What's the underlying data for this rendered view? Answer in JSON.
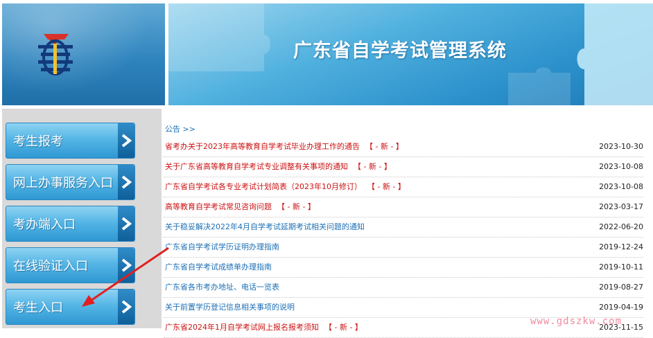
{
  "header": {
    "system_title": "广东省自学考试管理系统",
    "logo_icon": "provincial-emblem-icon",
    "colors": {
      "banner": "#2a8fca",
      "logo_panel": "#2f84be"
    }
  },
  "nav": {
    "items": [
      {
        "label": "考生报考"
      },
      {
        "label": "网上办事服务入口"
      },
      {
        "label": "考办端入口"
      },
      {
        "label": "在线验证入口"
      },
      {
        "label": "考生入口"
      }
    ],
    "arrow_icon": "chevron-right-icon"
  },
  "notices": {
    "header": "公告 >>",
    "new_badge": "【 - 新 - 】",
    "items": [
      {
        "title": "省考办关于2023年高等教育自学考试毕业办理工作的通告",
        "date": "2023-10-30",
        "is_new": true
      },
      {
        "title": "关于广东省高等教育自学考试专业调整有关事项的通知",
        "date": "2023-10-08",
        "is_new": true
      },
      {
        "title": "广东省自学考试各专业考试计划简表（2023年10月修订）",
        "date": "2023-10-08",
        "is_new": true
      },
      {
        "title": "高等教育自学考试常见咨询问题",
        "date": "2023-03-17",
        "is_new": true
      },
      {
        "title": "关于稳妥解决2022年4月自学考试延期考试相关问题的通知",
        "date": "2022-06-20",
        "is_new": false
      },
      {
        "title": "广东省自学考试学历证明办理指南",
        "date": "2019-12-24",
        "is_new": false
      },
      {
        "title": "广东省自学考试成绩单办理指南",
        "date": "2019-10-11",
        "is_new": false
      },
      {
        "title": "广东省各市考办地址、电话一览表",
        "date": "2019-08-27",
        "is_new": false
      },
      {
        "title": "关于前置学历登记信息相关事项的说明",
        "date": "2019-04-19",
        "is_new": false
      },
      {
        "title": "广东省2024年1月自学考试网上报名报考须知",
        "date": "2023-11-15",
        "is_new": true
      }
    ],
    "colors": {
      "new_title": "#cc1111",
      "old_title": "#1c6fb5"
    }
  },
  "watermark": {
    "text": "www.gdszkw.com"
  },
  "annotation": {
    "arrow_color": "#e02020"
  }
}
